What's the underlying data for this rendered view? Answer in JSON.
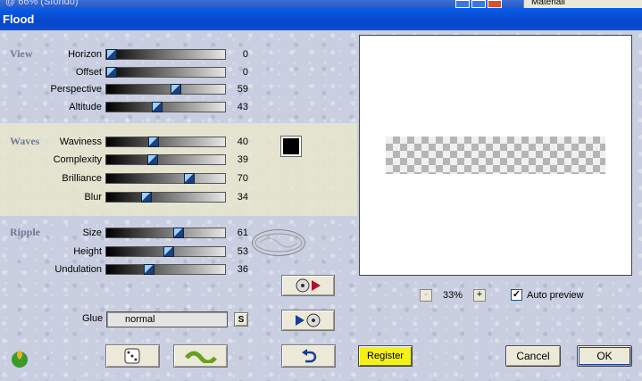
{
  "host": {
    "title_fragment": "@ 66% (Sfondo)",
    "panel_label": "Materiali"
  },
  "dialog": {
    "title": "Flood"
  },
  "sections": {
    "view": "View",
    "waves": "Waves",
    "ripple": "Ripple"
  },
  "sliders": {
    "horizon": {
      "label": "Horizon",
      "value": "0",
      "fraction": 0.0
    },
    "offset": {
      "label": "Offset",
      "value": "0",
      "fraction": 0.0
    },
    "perspective": {
      "label": "Perspective",
      "value": "59",
      "fraction": 0.59
    },
    "altitude": {
      "label": "Altitude",
      "value": "43",
      "fraction": 0.43
    },
    "waviness": {
      "label": "Waviness",
      "value": "40",
      "fraction": 0.4
    },
    "complexity": {
      "label": "Complexity",
      "value": "39",
      "fraction": 0.39
    },
    "brilliance": {
      "label": "Brilliance",
      "value": "70",
      "fraction": 0.7
    },
    "blur": {
      "label": "Blur",
      "value": "34",
      "fraction": 0.34
    },
    "size": {
      "label": "Size",
      "value": "61",
      "fraction": 0.61
    },
    "height": {
      "label": "Height",
      "value": "53",
      "fraction": 0.53
    },
    "undulation": {
      "label": "Undulation",
      "value": "36",
      "fraction": 0.36
    }
  },
  "wave_color": "#000000",
  "glue": {
    "label": "Glue",
    "value": "normal",
    "shortcut": "S"
  },
  "preview": {
    "zoom": "33%",
    "zoom_minus": "-",
    "zoom_plus": "+",
    "auto_preview_label": "Auto preview",
    "auto_preview_checked": "✓"
  },
  "buttons": {
    "register": "Register",
    "cancel": "Cancel",
    "ok": "OK"
  },
  "colors": {
    "register_bg": "#f3f01a",
    "titlebar": "#0a5ee8"
  }
}
